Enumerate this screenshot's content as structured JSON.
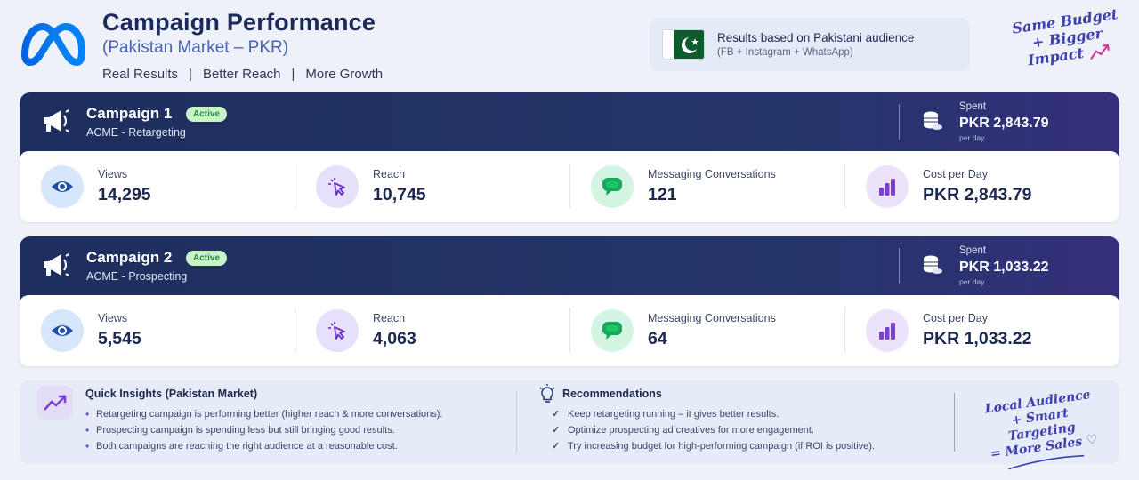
{
  "header": {
    "title": "Campaign Performance",
    "subtitle": "(Pakistan Market – PKR)",
    "taglines": [
      "Real Results",
      "Better Reach",
      "More Growth"
    ],
    "separator": "|"
  },
  "audience": {
    "title": "Results based on Pakistani audience",
    "sub": "(FB + Instagram + WhatsApp)"
  },
  "slogan": [
    "Same Budget",
    "+ Bigger",
    "Impact"
  ],
  "colors": {
    "header_bg": "#1e2e5e",
    "accent_purple": "#7b3fd2",
    "badge_green": "#c8f3c9",
    "meta_blue": "#1877f2"
  },
  "campaigns": [
    {
      "name": "Campaign 1",
      "badge": "Active",
      "subtitle": "ACME - Retargeting",
      "spent_label": "Spent",
      "spent_value": "PKR 2,843.79",
      "per_day": "per day",
      "metrics": [
        {
          "label": "Views",
          "value": "14,295",
          "icon": "eye-icon"
        },
        {
          "label": "Reach",
          "value": "10,745",
          "icon": "cursor-click-icon"
        },
        {
          "label": "Messaging Conversations",
          "value": "121",
          "icon": "chat-icon"
        },
        {
          "label": "Cost per Day",
          "value": "PKR 2,843.79",
          "icon": "bar-chart-icon"
        }
      ]
    },
    {
      "name": "Campaign 2",
      "badge": "Active",
      "subtitle": "ACME - Prospecting",
      "spent_label": "Spent",
      "spent_value": "PKR 1,033.22",
      "per_day": "per day",
      "metrics": [
        {
          "label": "Views",
          "value": "5,545",
          "icon": "eye-icon"
        },
        {
          "label": "Reach",
          "value": "4,063",
          "icon": "cursor-click-icon"
        },
        {
          "label": "Messaging Conversations",
          "value": "64",
          "icon": "chat-icon"
        },
        {
          "label": "Cost per Day",
          "value": "PKR 1,033.22",
          "icon": "bar-chart-icon"
        }
      ]
    }
  ],
  "insights": {
    "title": "Quick Insights (Pakistan Market)",
    "items": [
      "Retargeting campaign is performing better (higher reach & more conversations).",
      "Prospecting campaign is spending less but still bringing good results.",
      "Both campaigns are reaching the right audience at a reasonable cost."
    ]
  },
  "recommendations": {
    "title": "Recommendations",
    "items": [
      "Keep retargeting running – it gives better results.",
      "Optimize prospecting ad creatives for more engagement.",
      "Try increasing budget for high-performing campaign (if ROI is positive)."
    ]
  },
  "slogan2": [
    "Local Audience",
    "+ Smart Targeting",
    "= More Sales ♡"
  ]
}
